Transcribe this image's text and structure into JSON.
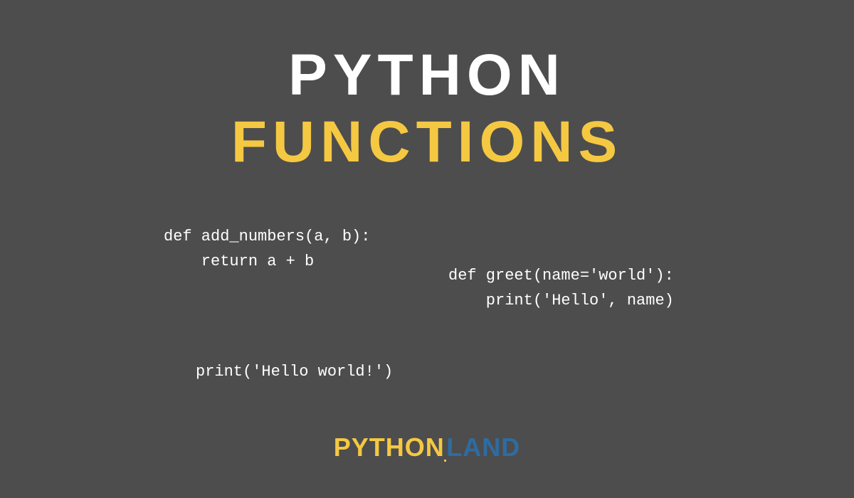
{
  "title": {
    "line1": "PYTHON",
    "line2": "FUNCTIONS"
  },
  "code_snippets": {
    "snippet1": "def add_numbers(a, b):\n    return a + b",
    "snippet2": "def greet(name='world'):\n    print('Hello', name)",
    "snippet3": "print('Hello world!')"
  },
  "footer": {
    "logo_part1": "PYTHON",
    "logo_dot": ".",
    "logo_part2": "LAND"
  },
  "colors": {
    "background": "#4d4d4d",
    "white": "#ffffff",
    "yellow": "#f5c842",
    "blue": "#2d6ca2"
  }
}
